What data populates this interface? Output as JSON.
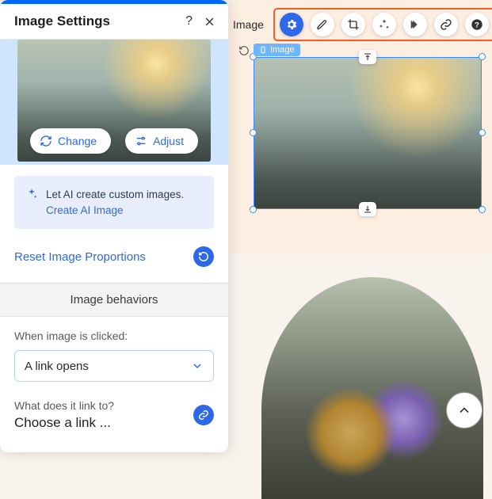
{
  "panel": {
    "title": "Image Settings",
    "help": "?",
    "change_label": "Change",
    "adjust_label": "Adjust",
    "ai_text": "Let AI create custom images. ",
    "ai_link": "Create AI Image",
    "reset_label": "Reset Image Proportions",
    "behaviors_header": "Image behaviors",
    "click_label": "When image is clicked:",
    "click_value": "A link opens",
    "link_to_label": "What does it link to?",
    "link_to_value": "Choose a link ..."
  },
  "toolbar": {
    "element_label": "Image",
    "badge": "Image"
  },
  "colors": {
    "accent": "#2f68e6",
    "highlight": "#ff5a1f"
  }
}
